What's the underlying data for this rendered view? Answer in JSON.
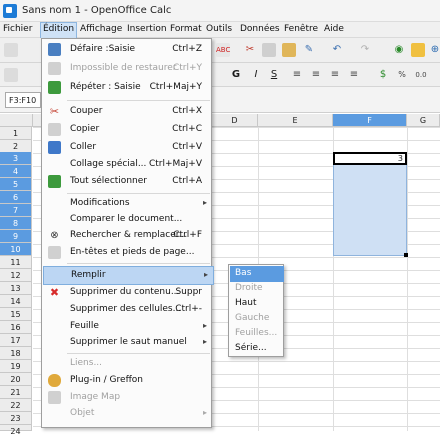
{
  "window": {
    "title": "Sans nom 1 - OpenOffice Calc"
  },
  "menubar": [
    "Fichier",
    "Édition",
    "Affichage",
    "Insertion",
    "Format",
    "Outils",
    "Données",
    "Fenêtre",
    "Aide"
  ],
  "namebox": {
    "value": "F3:F10"
  },
  "columns": [
    "D",
    "E",
    "F",
    "G"
  ],
  "rows": [
    "1",
    "2",
    "3",
    "4",
    "5",
    "6",
    "7",
    "8",
    "9",
    "10",
    "11",
    "12",
    "13",
    "14",
    "15",
    "16",
    "17",
    "18",
    "19",
    "20",
    "21",
    "22",
    "23",
    "24"
  ],
  "cell": {
    "F3": "3"
  },
  "edit_menu": {
    "items": [
      {
        "label": "Défaire :Saisie",
        "shortcut": "Ctrl+Z",
        "icon": "undo-icon",
        "disabled": false,
        "submenu": false,
        "highlight": false
      },
      {
        "label": "Impossible de restaurer",
        "shortcut": "Ctrl+Y",
        "icon": "redo-icon",
        "disabled": true,
        "submenu": false,
        "highlight": false
      },
      {
        "label": "Répéter : Saisie",
        "shortcut": "Ctrl+Maj+Y",
        "icon": "repeat-icon",
        "disabled": false,
        "submenu": false,
        "highlight": false
      },
      {
        "label": "Couper",
        "shortcut": "Ctrl+X",
        "icon": "scissors-icon",
        "disabled": false,
        "submenu": false,
        "highlight": false
      },
      {
        "label": "Copier",
        "shortcut": "Ctrl+C",
        "icon": "copy-icon",
        "disabled": false,
        "submenu": false,
        "highlight": false
      },
      {
        "label": "Coller",
        "shortcut": "Ctrl+V",
        "icon": "paste-icon",
        "disabled": false,
        "submenu": false,
        "highlight": false
      },
      {
        "label": "Collage spécial...",
        "shortcut": "Ctrl+Maj+V",
        "icon": "",
        "disabled": false,
        "submenu": false,
        "highlight": false
      },
      {
        "label": "Tout sélectionner",
        "shortcut": "Ctrl+A",
        "icon": "select-all-icon",
        "disabled": false,
        "submenu": false,
        "highlight": false
      },
      {
        "label": "Modifications",
        "shortcut": "",
        "icon": "",
        "disabled": false,
        "submenu": true,
        "highlight": false
      },
      {
        "label": "Comparer le document...",
        "shortcut": "",
        "icon": "",
        "disabled": false,
        "submenu": false,
        "highlight": false
      },
      {
        "label": "Rechercher & remplacer...",
        "shortcut": "Ctrl+F",
        "icon": "binoculars-icon",
        "disabled": false,
        "submenu": false,
        "highlight": false
      },
      {
        "label": "En-têtes et pieds de page...",
        "shortcut": "",
        "icon": "header-footer-icon",
        "disabled": false,
        "submenu": false,
        "highlight": false
      },
      {
        "label": "Remplir",
        "shortcut": "",
        "icon": "",
        "disabled": false,
        "submenu": true,
        "highlight": true
      },
      {
        "label": "Supprimer du contenu...",
        "shortcut": "Suppr",
        "icon": "delete-icon",
        "disabled": false,
        "submenu": false,
        "highlight": false
      },
      {
        "label": "Supprimer des cellules...",
        "shortcut": "Ctrl+-",
        "icon": "",
        "disabled": false,
        "submenu": false,
        "highlight": false
      },
      {
        "label": "Feuille",
        "shortcut": "",
        "icon": "",
        "disabled": false,
        "submenu": true,
        "highlight": false
      },
      {
        "label": "Supprimer le saut manuel",
        "shortcut": "",
        "icon": "",
        "disabled": false,
        "submenu": true,
        "highlight": false
      },
      {
        "label": "Liens...",
        "shortcut": "",
        "icon": "",
        "disabled": true,
        "submenu": false,
        "highlight": false
      },
      {
        "label": "Plug-in / Greffon",
        "shortcut": "",
        "icon": "plugin-icon",
        "disabled": false,
        "submenu": false,
        "highlight": false
      },
      {
        "label": "Image Map",
        "shortcut": "",
        "icon": "image-map-icon",
        "disabled": true,
        "submenu": false,
        "highlight": false
      },
      {
        "label": "Objet",
        "shortcut": "",
        "icon": "",
        "disabled": true,
        "submenu": true,
        "highlight": false
      }
    ]
  },
  "fill_submenu": {
    "items": [
      {
        "label": "Bas",
        "disabled": false,
        "highlight": true
      },
      {
        "label": "Droite",
        "disabled": true,
        "highlight": false
      },
      {
        "label": "Haut",
        "disabled": false,
        "highlight": false
      },
      {
        "label": "Gauche",
        "disabled": true,
        "highlight": false
      },
      {
        "label": "Feuilles...",
        "disabled": true,
        "highlight": false
      },
      {
        "label": "Série...",
        "disabled": false,
        "highlight": false
      }
    ]
  },
  "toolbar2": {
    "bold": "G",
    "italic": "I",
    "underline": "S"
  }
}
